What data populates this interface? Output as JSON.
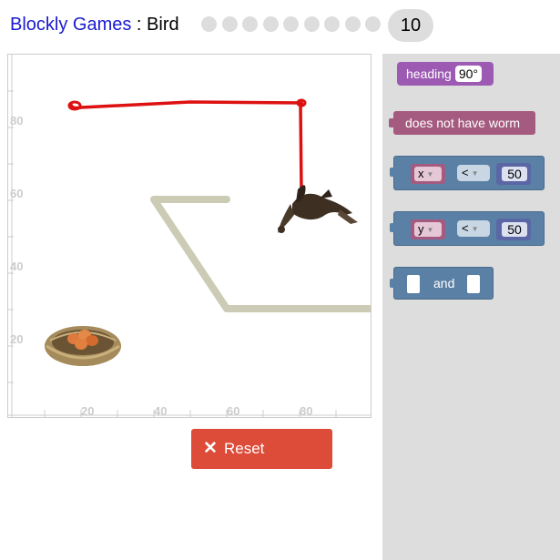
{
  "header": {
    "app_name": "Blockly Games",
    "separator": " : ",
    "game_name": "Bird",
    "level_count": 9,
    "current_level": "10"
  },
  "canvas": {
    "x_tick_labels": [
      "20",
      "40",
      "60",
      "80"
    ],
    "y_tick_labels": [
      "20",
      "40",
      "60",
      "80"
    ],
    "icons": {
      "bird": "bird-icon",
      "nest": "nest-with-eggs-icon"
    }
  },
  "reset": {
    "label": "Reset",
    "icon": "close-icon"
  },
  "toolbox": {
    "heading": {
      "label": "heading",
      "value": "90°"
    },
    "no_worm": {
      "label": "does not have worm"
    },
    "compare_x": {
      "var": "x",
      "op": "<",
      "num": "50"
    },
    "compare_y": {
      "var": "y",
      "op": "<",
      "num": "50"
    },
    "and_block": {
      "label": "and"
    }
  },
  "colors": {
    "path": "#dd1111",
    "wall": "#cccbb5",
    "reset_button": "#dd4b39",
    "heading_block": "#9d5ab3",
    "worm_block": "#a55b80",
    "logic_block": "#5b80a5"
  }
}
